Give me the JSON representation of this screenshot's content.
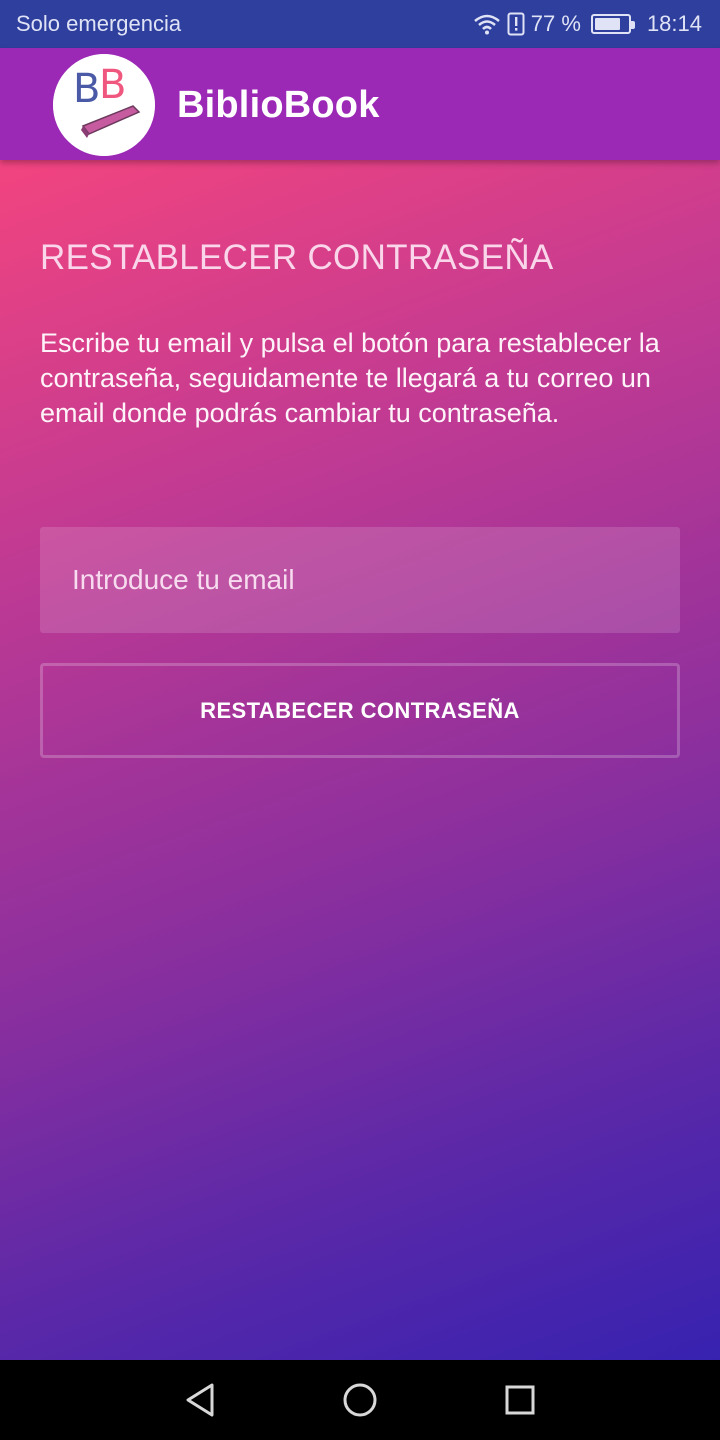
{
  "status_bar": {
    "carrier": "Solo emergencia",
    "battery_percent": "77 %",
    "battery_level": 0.77,
    "time": "18:14",
    "icons": [
      "wifi-icon",
      "alert-icon",
      "battery-icon"
    ]
  },
  "app_bar": {
    "title": "BiblioBook",
    "logo_icon": "bibliobook-logo"
  },
  "main": {
    "page_title": "RESTABLECER CONTRASEÑA",
    "description": "Escribe tu email y pulsa el botón para restablecer la contraseña, seguidamente te llegará a tu correo un email donde podrás cambiar tu contraseña.",
    "email_placeholder": "Introduce tu email",
    "email_value": "",
    "reset_button_label": "RESTABECER CONTRASEÑA"
  },
  "nav_bar": {
    "icons": [
      "back-icon",
      "home-icon",
      "recents-icon"
    ]
  },
  "colors": {
    "status_bar": "#2f3f9e",
    "app_bar": "#9b29b6",
    "gradient_start": "#f2447f",
    "gradient_end": "#3722b0"
  }
}
